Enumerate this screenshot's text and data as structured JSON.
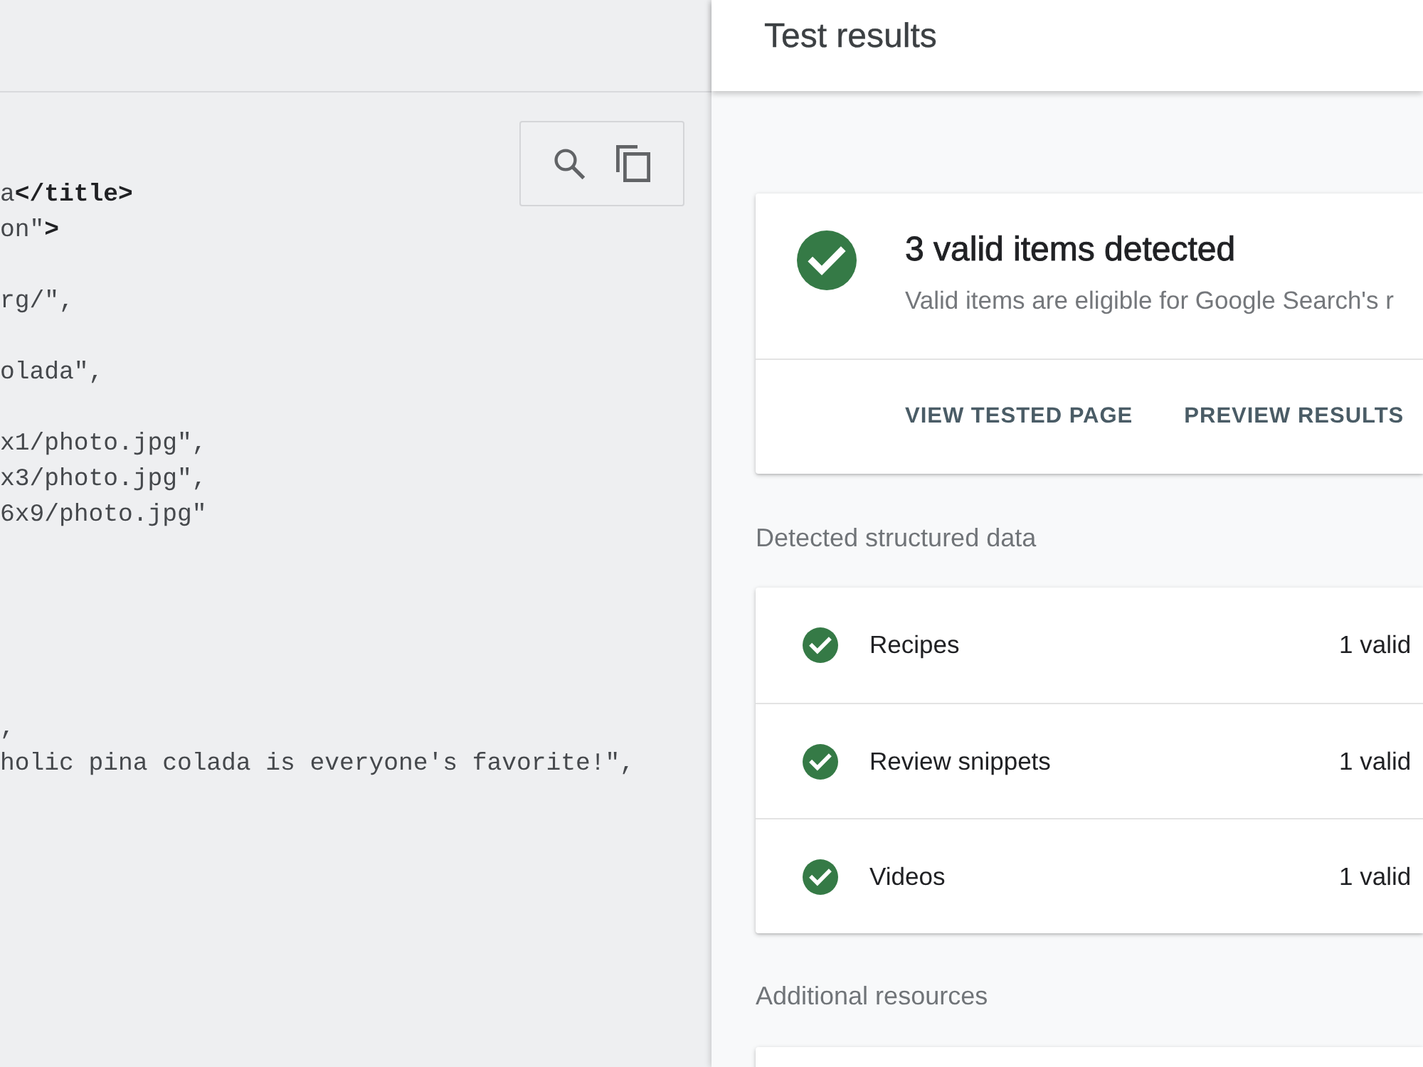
{
  "code_view": {
    "code": "a**</title>**\non\"**>**\n\nrg/\",\n\nolada\",\n\nx1/photo.jpg\",\nx3/photo.jpg\",\n6x9/photo.jpg\"\n\n\n\n\n\n,\nholic pina colada is everyone's favorite!\","
  },
  "results_panel": {
    "title": "Test results",
    "summary": {
      "valid": true,
      "title": "3 valid items detected",
      "description": "Valid items are eligible for Google Search's r",
      "actions": [
        "VIEW TESTED PAGE",
        "PREVIEW RESULTS"
      ]
    },
    "detected_section": {
      "heading": "Detected structured data",
      "items": [
        {
          "name": "Recipes",
          "valid": true,
          "count": "1 valid"
        },
        {
          "name": "Review snippets",
          "valid": true,
          "count": "1 valid"
        },
        {
          "name": "Videos",
          "valid": true,
          "count": "1 valid"
        }
      ]
    },
    "resources_section": {
      "heading": "Additional resources"
    }
  }
}
